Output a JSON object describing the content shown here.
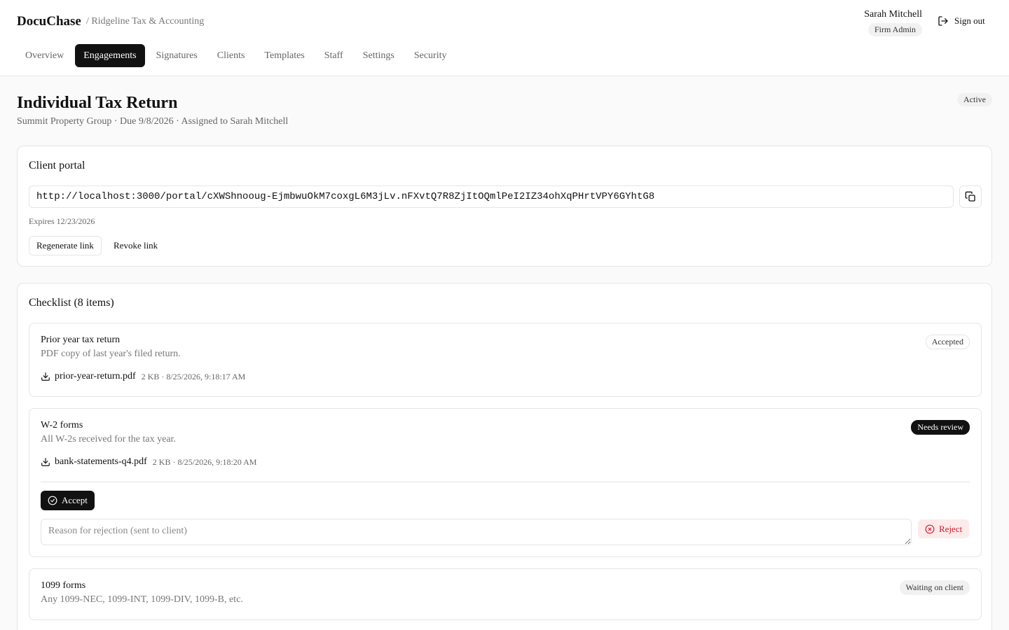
{
  "app": {
    "brand": "DocuChase",
    "org": "/ Ridgeline Tax & Accounting"
  },
  "user": {
    "name": "Sarah Mitchell",
    "role": "Firm Admin",
    "signout_label": "Sign out"
  },
  "nav": {
    "items": [
      {
        "label": "Overview",
        "active": false
      },
      {
        "label": "Engagements",
        "active": true
      },
      {
        "label": "Signatures",
        "active": false
      },
      {
        "label": "Clients",
        "active": false
      },
      {
        "label": "Templates",
        "active": false
      },
      {
        "label": "Staff",
        "active": false
      },
      {
        "label": "Settings",
        "active": false
      },
      {
        "label": "Security",
        "active": false
      }
    ]
  },
  "engagement": {
    "title": "Individual Tax Return",
    "subtitle": "Summit Property Group · Due 9/8/2026 · Assigned to Sarah Mitchell",
    "status": "Active"
  },
  "portal": {
    "title": "Client portal",
    "url": "http://localhost:3000/portal/cXWShnooug-EjmbwuOkM7coxgL6M3jLv.nFXvtQ7R8ZjItOQmlPeI2IZ34ohXqPHrtVPY6GYhtG8",
    "expires": "Expires 12/23/2026",
    "regenerate_label": "Regenerate link",
    "revoke_label": "Revoke link"
  },
  "checklist": {
    "title": "Checklist (8 items)",
    "items": [
      {
        "title": "Prior year tax return",
        "description": "PDF copy of last year's filed return.",
        "status": "Accepted",
        "file": {
          "name": "prior-year-return.pdf",
          "meta": "2 KB · 8/25/2026, 9:18:17 AM"
        }
      },
      {
        "title": "W-2 forms",
        "description": "All W-2s received for the tax year.",
        "status": "Needs review",
        "file": {
          "name": "bank-statements-q4.pdf",
          "meta": "2 KB · 8/25/2026, 9:18:20 AM"
        },
        "accept_label": "Accept",
        "reason_placeholder": "Reason for rejection (sent to client)",
        "reject_label": "Reject"
      },
      {
        "title": "1099 forms",
        "description": "Any 1099-NEC, 1099-INT, 1099-DIV, 1099-B, etc.",
        "status": "Waiting on client"
      }
    ]
  },
  "colors": {
    "primary": "#111111",
    "reject": "#d11a2a",
    "reject_bg": "#fdeaea",
    "border": "#e5e5e5"
  },
  "icons": {
    "signout": "sign-out-icon",
    "copy": "copy-icon",
    "download": "download-icon",
    "accept": "check-circle-icon",
    "reject": "x-circle-icon"
  }
}
